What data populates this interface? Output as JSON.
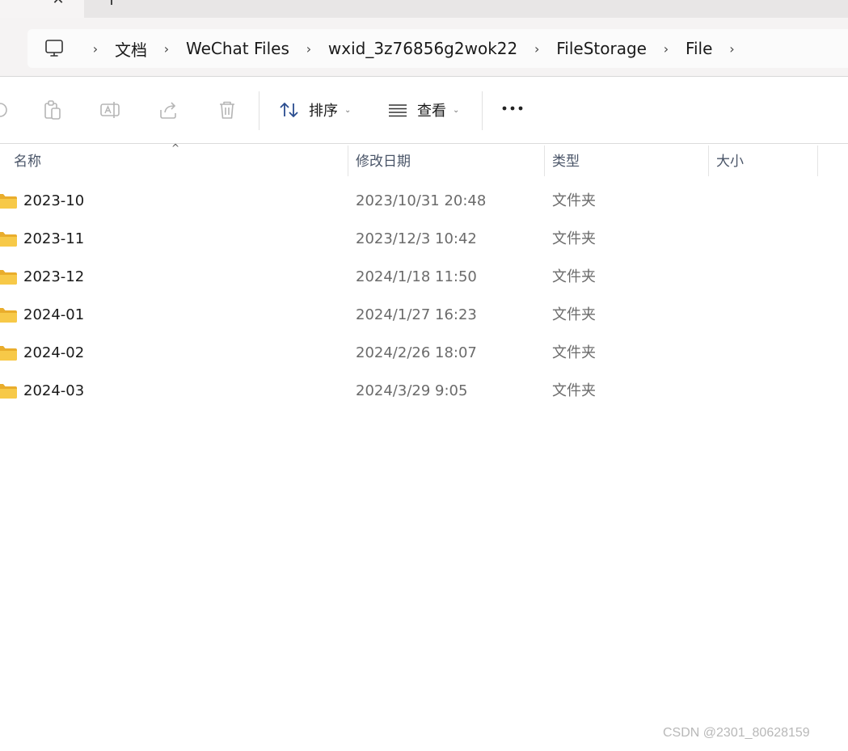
{
  "tabs": {
    "close_glyph": "✕",
    "new_glyph": "+"
  },
  "breadcrumb": {
    "separator": "›",
    "items": [
      "文档",
      "WeChat Files",
      "wxid_3z76856g2wok22",
      "FileStorage",
      "File"
    ]
  },
  "toolbar": {
    "sort_label": "排序",
    "view_label": "查看",
    "icons": [
      "paste-icon",
      "rename-icon",
      "share-icon",
      "delete-icon",
      "sort-icon",
      "view-icon",
      "more-icon"
    ]
  },
  "columns": {
    "name": "名称",
    "modified": "修改日期",
    "type": "类型",
    "size": "大小",
    "sort_indicator": "^"
  },
  "files": [
    {
      "name": "2023-10",
      "modified": "2023/10/31 20:48",
      "type": "文件夹"
    },
    {
      "name": "2023-11",
      "modified": "2023/12/3 10:42",
      "type": "文件夹"
    },
    {
      "name": "2023-12",
      "modified": "2024/1/18 11:50",
      "type": "文件夹"
    },
    {
      "name": "2024-01",
      "modified": "2024/1/27 16:23",
      "type": "文件夹"
    },
    {
      "name": "2024-02",
      "modified": "2024/2/26 18:07",
      "type": "文件夹"
    },
    {
      "name": "2024-03",
      "modified": "2024/3/29 9:05",
      "type": "文件夹"
    }
  ],
  "watermark": "CSDN @2301_80628159",
  "colors": {
    "folder": "#f7c948",
    "folder_dark": "#e9ad2c",
    "accent": "#1a73e8"
  }
}
